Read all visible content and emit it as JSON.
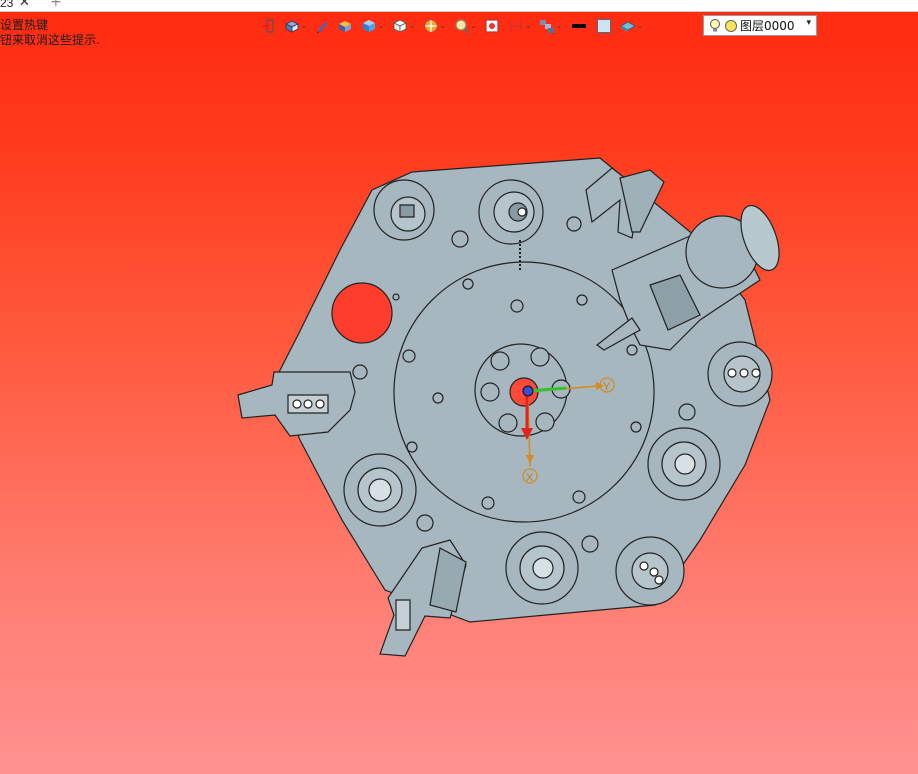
{
  "tab": {
    "label": "23",
    "close_icon": "close-icon",
    "add_icon": "plus-icon"
  },
  "hint": {
    "line1": "设置热键",
    "line2": "钮来取消这些提示."
  },
  "toolbar": {
    "icons": [
      "exit-sketch-icon",
      "view-orientation-icon",
      "pen-icon",
      "shaded-cube-icon",
      "blue-cube-icon",
      "white-cube-icon",
      "section-view-icon",
      "zoom-icon",
      "render-icon",
      "dimension-icon",
      "layers-icon",
      "line-color-icon",
      "fill-color-icon",
      "material-icon"
    ]
  },
  "layer": {
    "name": "图层0000",
    "bulb_icon": "lightbulb-icon",
    "state_icon": "layer-state-icon"
  },
  "axes": {
    "x_label": "X",
    "y_label": "Y"
  },
  "colors": {
    "part_fill": "#a6b7bf",
    "part_stroke": "#222222",
    "background_top": "#ff2a10",
    "background_bottom": "#ff9290"
  }
}
